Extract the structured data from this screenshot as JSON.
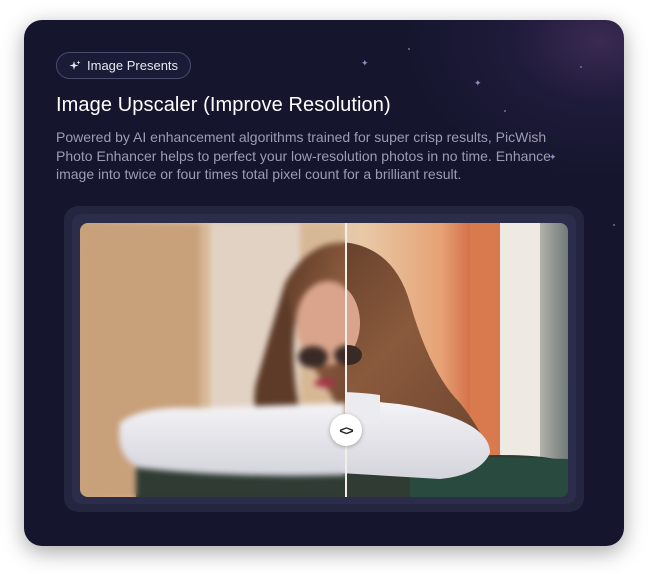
{
  "badge": {
    "label": "Image Presents",
    "icon": "sparkle-icon"
  },
  "title": "Image Upscaler (Improve Resolution)",
  "description": "Powered by AI enhancement algorithms trained for super crisp results, PicWish Photo Enhancer helps to perfect your low-resolution photos in no time. Enhance image into twice or four times total pixel count for a brilliant result.",
  "comparison": {
    "handle_glyph": "<>",
    "handle_icon": "chevrons-left-right-icon",
    "split_position": 0.54
  },
  "colors": {
    "card_background": "#15162e",
    "accent_glow": "#3a2a52",
    "title": "#ffffff",
    "description": "#9b9db3"
  }
}
